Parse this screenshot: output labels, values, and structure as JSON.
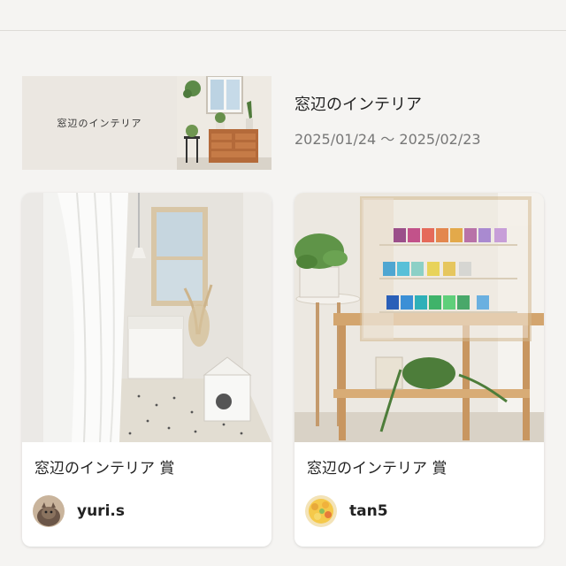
{
  "event": {
    "banner_label": "窓辺のインテリア",
    "title": "窓辺のインテリア",
    "dates": "2025/01/24 〜 2025/02/23"
  },
  "awards": [
    {
      "label": "窓辺のインテリア 賞",
      "username": "yuri.s"
    },
    {
      "label": "窓辺のインテリア 賞",
      "username": "tan5"
    }
  ],
  "icons": {
    "avatar_1": "cat-avatar",
    "avatar_2": "food-avatar"
  }
}
